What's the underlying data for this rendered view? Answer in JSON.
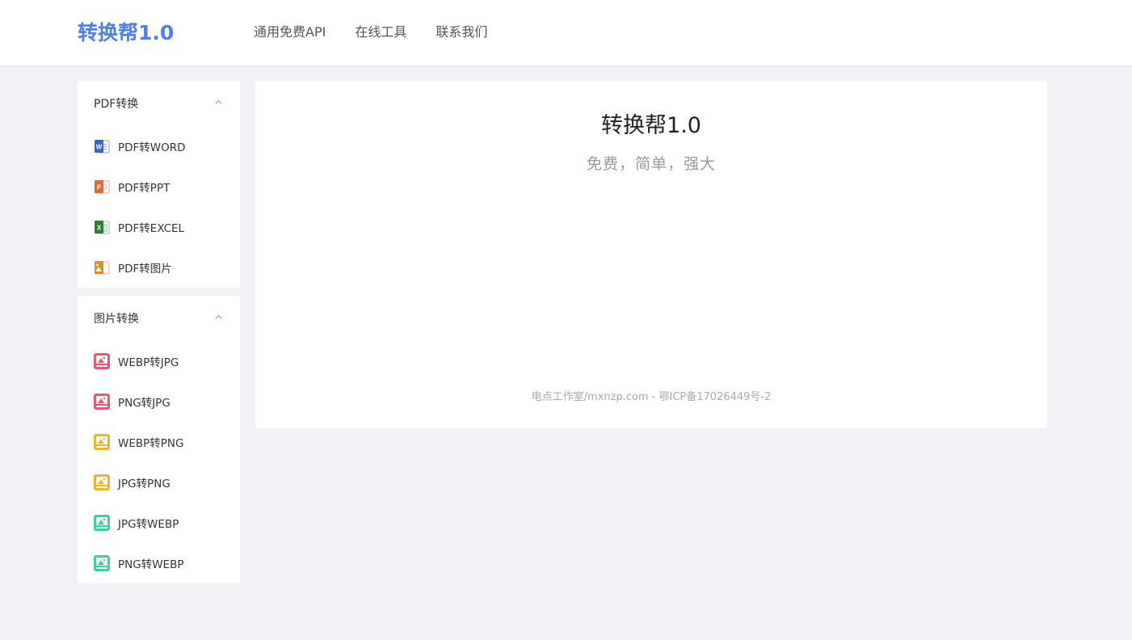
{
  "header": {
    "logo": "转换帮1.0",
    "nav": [
      "通用免费API",
      "在线工具",
      "联系我们"
    ]
  },
  "sidebar": {
    "groups": [
      {
        "title": "PDF转换",
        "items": [
          {
            "label": "PDF转WORD",
            "icon": "word-file-icon",
            "color": "#3b5fc4"
          },
          {
            "label": "PDF转PPT",
            "icon": "ppt-file-icon",
            "color": "#e06a2b"
          },
          {
            "label": "PDF转EXCEL",
            "icon": "excel-file-icon",
            "color": "#2e7d32"
          },
          {
            "label": "PDF转图片",
            "icon": "image-file-icon",
            "color": "#e38a2a"
          }
        ]
      },
      {
        "title": "图片转换",
        "items": [
          {
            "label": "WEBP转JPG",
            "icon": "image-convert-icon",
            "color": "#e85a6a"
          },
          {
            "label": "PNG转JPG",
            "icon": "image-convert-icon",
            "color": "#e85a6a"
          },
          {
            "label": "WEBP转PNG",
            "icon": "image-convert-icon",
            "color": "#f0b429"
          },
          {
            "label": "JPG转PNG",
            "icon": "image-convert-icon",
            "color": "#f0b429"
          },
          {
            "label": "JPG转WEBP",
            "icon": "image-convert-icon",
            "color": "#3ecfa5"
          },
          {
            "label": "PNG转WEBP",
            "icon": "image-convert-icon",
            "color": "#3ecfa5"
          }
        ]
      }
    ]
  },
  "main": {
    "title": "转换帮1.0",
    "subtitle": "免费，简单，强大",
    "footer": "电点工作室/mxnzp.com - 鄂ICP备17026449号-2"
  },
  "colors": {
    "brand": "#4e7ef0",
    "background": "#f1f2f6"
  }
}
